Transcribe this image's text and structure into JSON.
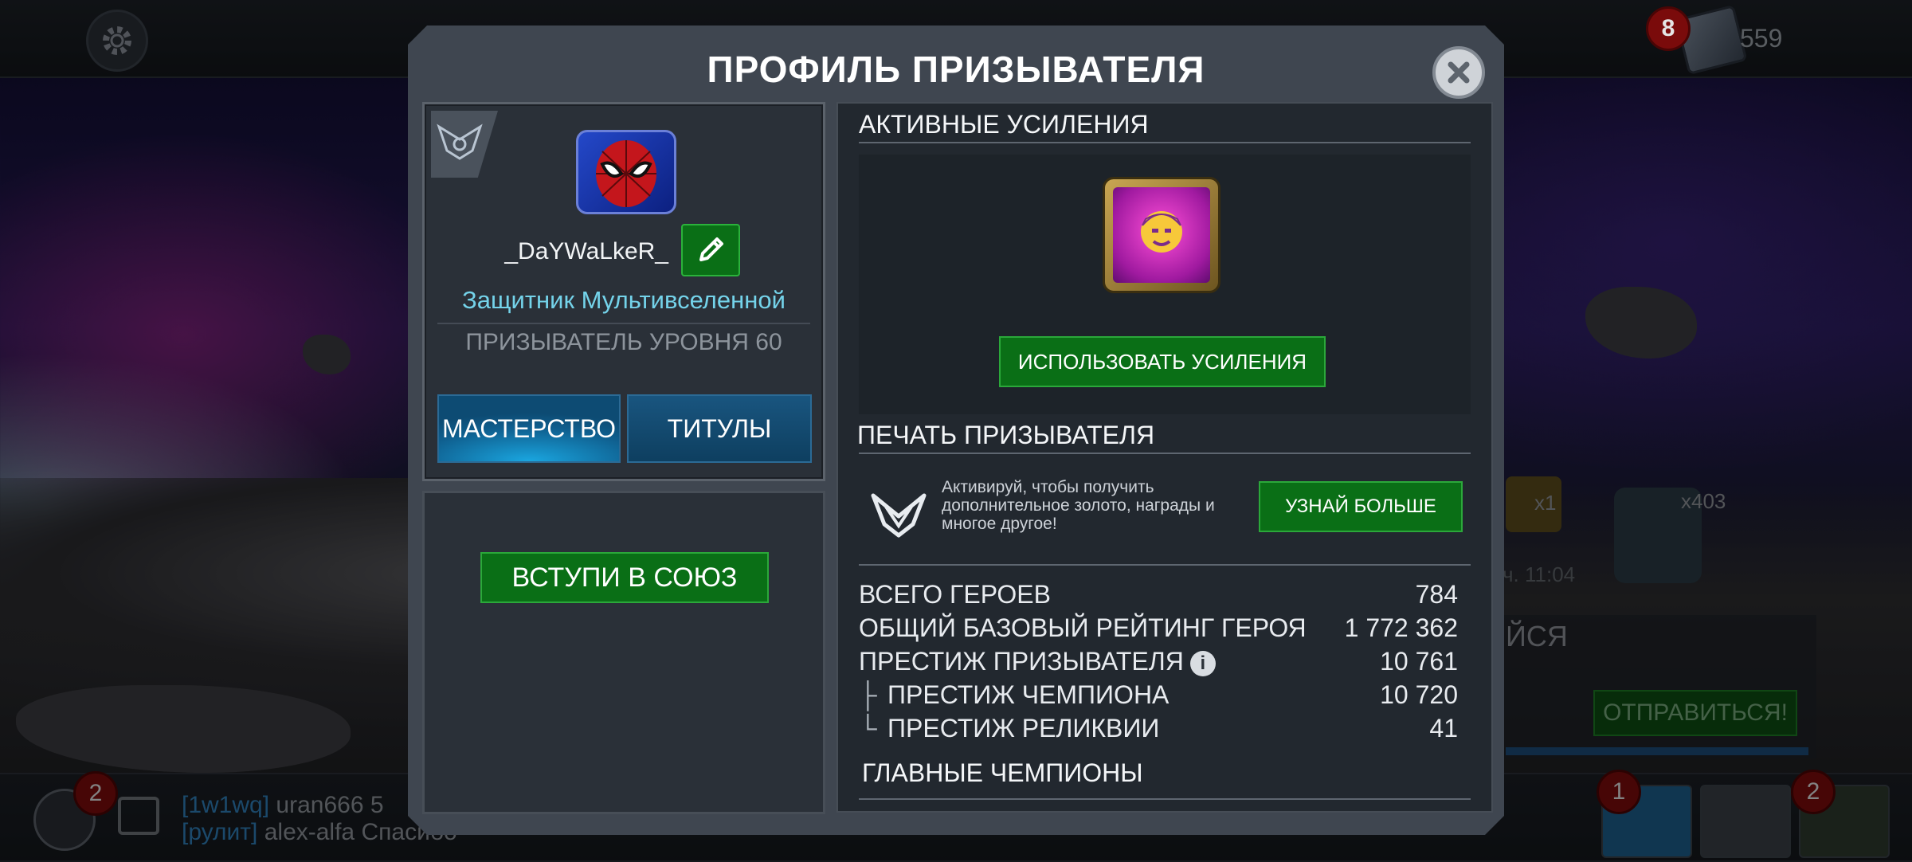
{
  "background": {
    "top_right_badge": "8",
    "units_count": "559",
    "chat": [
      {
        "channel": "[1w1wq]",
        "user": "uran666",
        "text": "5"
      },
      {
        "channel": "[рулит]",
        "user": "alex-alfa",
        "text": "Спасибо"
      }
    ],
    "friends_badge": "2",
    "quest": {
      "title_fragment": "ЙСЯ",
      "go_button": "ОТПРАВИТЬСЯ!",
      "reward1_qty": "x1",
      "reward2_qty": "x403",
      "time": "ч. 11:04"
    },
    "bottom_badges": [
      "1",
      "2"
    ],
    "partial_header_name": "DaYWaLkeR"
  },
  "modal": {
    "title": "ПРОФИЛЬ ПРИЗЫВАТЕЛЯ",
    "profile": {
      "username": "_DaYWaLkeR_",
      "title": "Защитник Мультивселенной",
      "level": "ПРИЗЫВАТЕЛЬ УРОВНЯ 60",
      "tab_mastery": "МАСТЕРСТВО",
      "tab_titles": "ТИТУЛЫ"
    },
    "alliance": {
      "join_button": "ВСТУПИ В СОЮЗ"
    },
    "boosts": {
      "heading": "АКТИВНЫЕ УСИЛЕНИЯ",
      "use_button": "ИСПОЛЬЗОВАТЬ УСИЛЕНИЯ"
    },
    "seal": {
      "heading": "ПЕЧАТЬ ПРИЗЫВАТЕЛЯ",
      "text": "Активируй, чтобы получить дополнительное золото, награды и многое другое!",
      "learn_button": "УЗНАЙ БОЛЬШЕ"
    },
    "stats": [
      {
        "label": "ВСЕГО ГЕРОЕВ",
        "value": "784"
      },
      {
        "label": "ОБЩИЙ БАЗОВЫЙ РЕЙТИНГ ГЕРОЯ",
        "value": "1 772 362"
      },
      {
        "label": "ПРЕСТИЖ ПРИЗЫВАТЕЛЯ",
        "value": "10 761"
      },
      {
        "label": "ПРЕСТИЖ ЧЕМПИОНА",
        "value": "10 720"
      },
      {
        "label": "ПРЕСТИЖ РЕЛИКВИИ",
        "value": "41"
      }
    ],
    "top_champions_heading": "ГЛАВНЫЕ ЧЕМПИОНЫ"
  },
  "colors": {
    "accent_cyan": "#74d3ea",
    "button_green": "#0a6f16",
    "tab_blue": "#0f5f8f",
    "badge_red": "#7a0b0b"
  },
  "icons": [
    "gear-icon",
    "units-icon",
    "close-icon",
    "rank-emblem-icon",
    "avatar-spiderman",
    "pencil-icon",
    "boost-icon",
    "summoner-seal-icon",
    "info-icon",
    "friends-icon",
    "chat-icon"
  ]
}
